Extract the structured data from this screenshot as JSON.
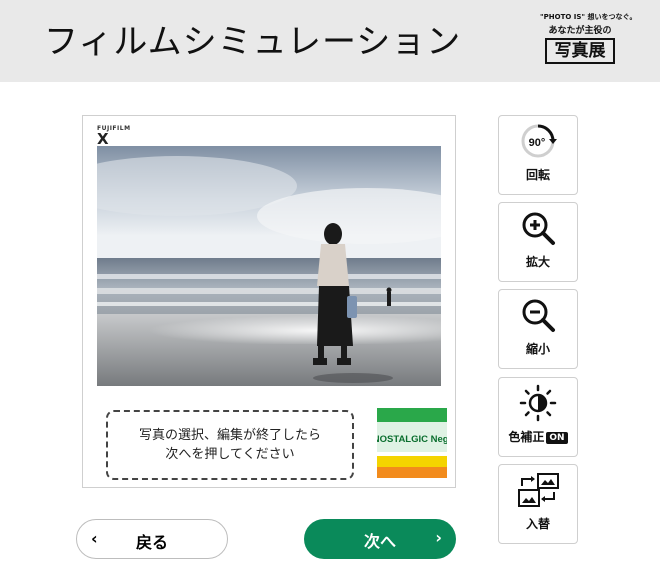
{
  "header": {
    "title": "フィルムシミュレーション",
    "logo": {
      "tagline": "\"PHOTO IS\" 想いをつなぐ。",
      "subtitle": "あなたが主役の",
      "main": "写真展"
    }
  },
  "preview": {
    "brand": "FUJIFILM",
    "brand_mark": "X",
    "photo_description": "woman standing on beach at sea shore",
    "message_line1": "写真の選択、編集が終了したら",
    "message_line2": "次へを押してください",
    "film_label": "NOSTALGIC Neg."
  },
  "tools": {
    "rotate": {
      "label": "回転",
      "icon_text": "90°",
      "icon": "rotate-icon"
    },
    "zoom_in": {
      "label": "拡大",
      "icon": "zoom-in-icon"
    },
    "zoom_out": {
      "label": "縮小",
      "icon": "zoom-out-icon"
    },
    "color": {
      "label": "色補正",
      "state": "ON",
      "icon": "brightness-icon"
    },
    "swap": {
      "label": "入替",
      "icon": "swap-images-icon"
    }
  },
  "nav": {
    "back_label": "戻る",
    "next_label": "次へ"
  },
  "colors": {
    "accent": "#0a8a5a",
    "header_bg": "#e9e9e9"
  }
}
